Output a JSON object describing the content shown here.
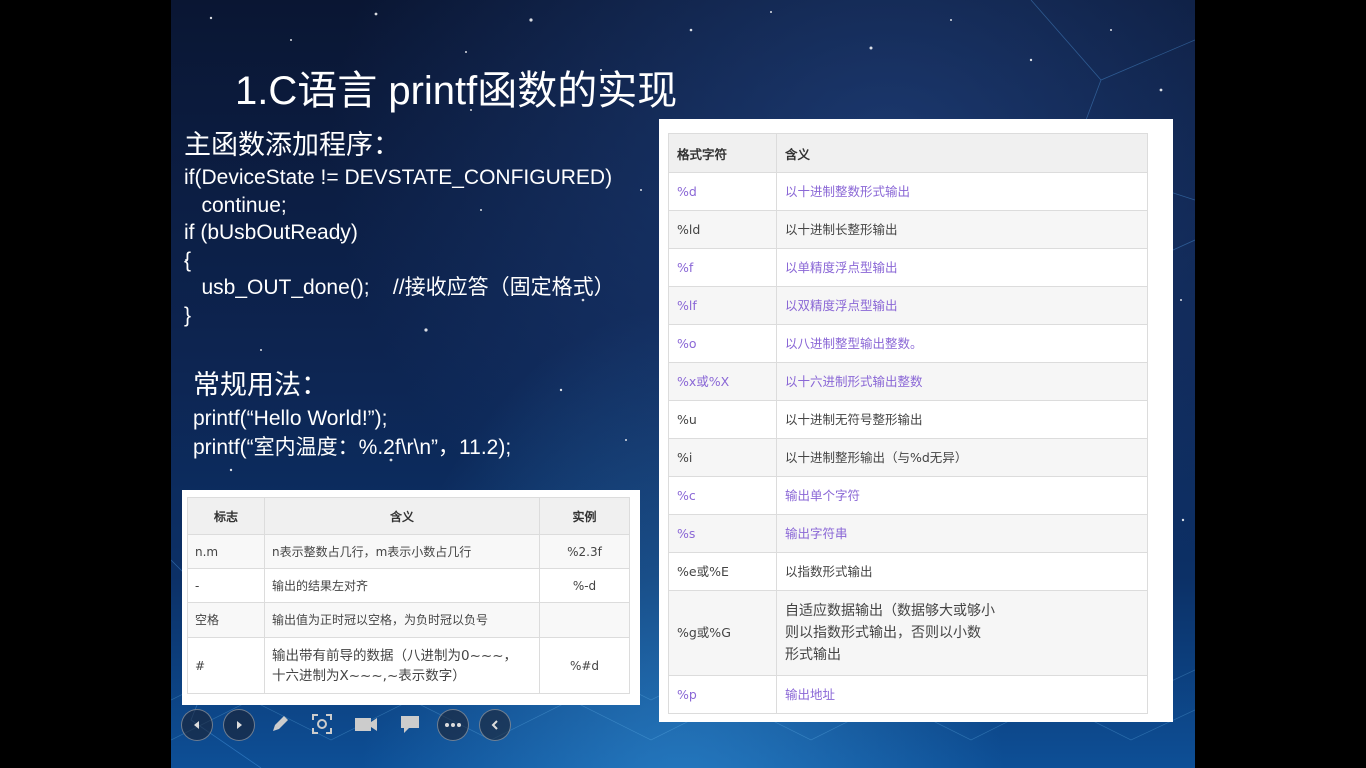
{
  "slide": {
    "title": "1.C语言 printf函数的实现"
  },
  "code_section": {
    "heading": "主函数添加程序：",
    "lines": [
      "if(DeviceState != DEVSTATE_CONFIGURED)",
      "   continue;",
      "if (bUsbOutReady)",
      "{",
      "   usb_OUT_done();    //接收应答（固定格式）",
      "}"
    ]
  },
  "usage_section": {
    "heading": "常规用法：",
    "lines": [
      "printf(“Hello World!”);",
      "printf(“室内温度：%.2f\\r\\n”，11.2);"
    ]
  },
  "flags_table": {
    "headers": [
      "标志",
      "含义",
      "实例"
    ],
    "rows": [
      {
        "flag": "n.m",
        "meaning": "n表示整数占几行，m表示小数占几行",
        "example": "%2.3f"
      },
      {
        "flag": "-",
        "meaning": "输出的结果左对齐",
        "example": "%-d"
      },
      {
        "flag": "空格",
        "meaning": "输出值为正时冠以空格，为负时冠以负号",
        "example": ""
      },
      {
        "flag": "#",
        "meaning_line1": "输出带有前导的数据（八进制为0~~~，",
        "meaning_line2": "十六进制为X~~~,~表示数字）",
        "example": "%#d"
      }
    ]
  },
  "format_table": {
    "headers": [
      "格式字符",
      "含义"
    ],
    "rows": [
      {
        "code": "%d",
        "meaning": "以十进制整数形式输出"
      },
      {
        "code": "%ld",
        "meaning": "以十进制长整形输出"
      },
      {
        "code": "%f",
        "meaning": "以单精度浮点型输出"
      },
      {
        "code": "%lf",
        "meaning": "以双精度浮点型输出"
      },
      {
        "code": "%o",
        "meaning": "以八进制整型输出整数。"
      },
      {
        "code": "%x或%X",
        "meaning": "以十六进制形式输出整数"
      },
      {
        "code": "%u",
        "meaning": "以十进制无符号整形输出"
      },
      {
        "code": "%i",
        "meaning": "以十进制整形输出（与%d无异）"
      },
      {
        "code": "%c",
        "meaning": "输出单个字符"
      },
      {
        "code": "%s",
        "meaning": "输出字符串"
      },
      {
        "code": "%e或%E",
        "meaning": "以指数形式输出"
      },
      {
        "code": "%g或%G",
        "meaning_line1": "自适应数据输出（数据够大或够小",
        "meaning_line2": "则以指数形式输出，否则以小数",
        "meaning_line3": "形式输出"
      },
      {
        "code": "%p",
        "meaning": "输出地址"
      }
    ]
  },
  "toolbar": {
    "buttons": [
      "previous-slide",
      "next-slide",
      "pen",
      "zoom",
      "camera",
      "comment",
      "more-options",
      "collapse-toolbar"
    ]
  },
  "colors": {
    "purple_text": "#8a67d6",
    "header_bg": "#f0f0f0",
    "slide_bg_top": "#0a1633",
    "slide_bg_bottom": "#0d4f96"
  }
}
